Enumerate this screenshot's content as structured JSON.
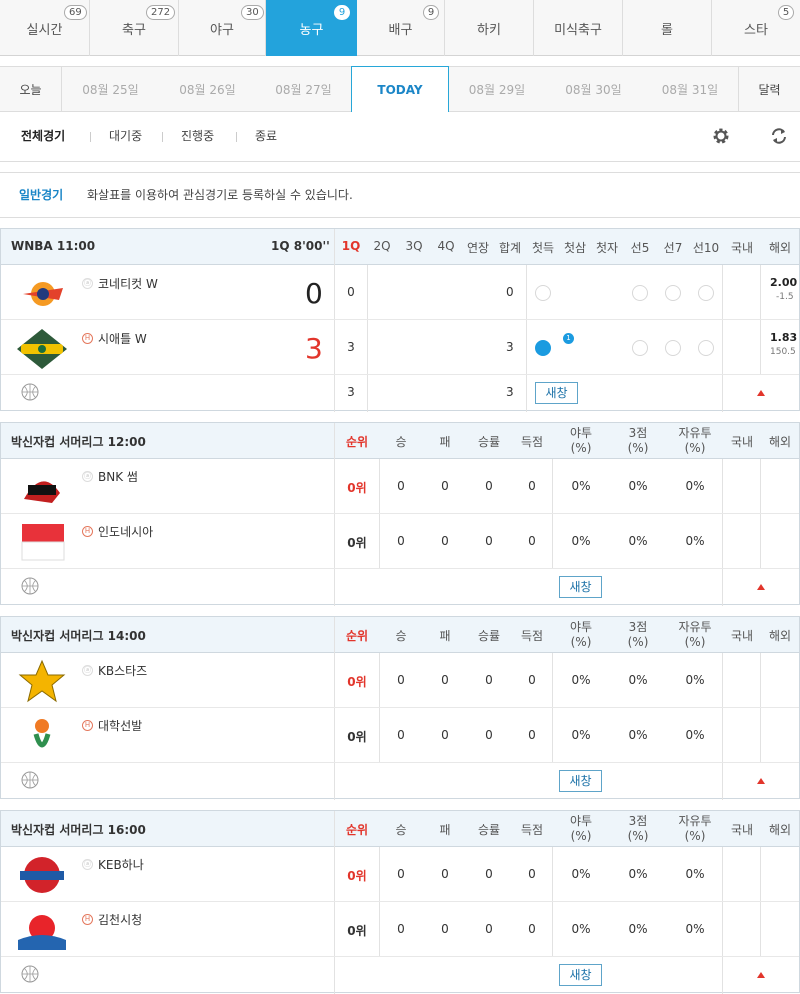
{
  "sport_tabs": [
    {
      "label": "실시간",
      "count": "69"
    },
    {
      "label": "축구",
      "count": "272"
    },
    {
      "label": "야구",
      "count": "30"
    },
    {
      "label": "농구",
      "count": "9",
      "active": true
    },
    {
      "label": "배구",
      "count": "9"
    },
    {
      "label": "하키",
      "count": ""
    },
    {
      "label": "미식축구",
      "count": ""
    },
    {
      "label": "롤",
      "count": ""
    },
    {
      "label": "스타",
      "count": "5"
    }
  ],
  "dates": [
    "오늘",
    "08월 25일",
    "08월 26일",
    "08월 27일",
    "TODAY",
    "08월 29일",
    "08월 30일",
    "08월 31일",
    "달력"
  ],
  "filters": [
    "전체경기",
    "대기중",
    "진행중",
    "종료"
  ],
  "notice": {
    "label": "일반경기",
    "text": "화살표를 이용하여 관심경기로 등록하실 수 있습니다."
  },
  "wnba": {
    "league": "WNBA  11:00",
    "status": "1Q 8'00''",
    "cols": [
      "1Q",
      "2Q",
      "3Q",
      "4Q",
      "연장",
      "합계",
      "첫득",
      "첫삼",
      "첫자",
      "선5",
      "선7",
      "선10",
      "국내",
      "해외"
    ],
    "home": {
      "name": "코네티컷 W",
      "badge": "ⓐ",
      "score": "0",
      "q1": "0",
      "total": "0",
      "odds": "2.00",
      "handicap": "-1.5"
    },
    "away": {
      "name": "시애틀 W",
      "badge": "H",
      "score": "3",
      "q1": "3",
      "total": "3",
      "odds": "1.83",
      "handicap": "150.5",
      "first_badge": "1"
    },
    "sum": {
      "q1": "3",
      "total": "3"
    },
    "new_btn": "새창"
  },
  "standings_cols": {
    "rank": "순위",
    "w": "승",
    "l": "패",
    "pct": "승률",
    "pts": "득점",
    "fg": "야투",
    "fg2": "(%)",
    "tp": "3점",
    "tp2": "(%)",
    "ft": "자유투",
    "ft2": "(%)",
    "dom": "국내",
    "ovs": "해외"
  },
  "games": [
    {
      "title": "박신자컵 서머리그  12:00",
      "teams": [
        {
          "name": "BNK 썸",
          "badge": "ⓐ",
          "rank": "0위",
          "red": true
        },
        {
          "name": "인도네시아",
          "badge": "H",
          "rank": "0위",
          "red": false
        }
      ],
      "new_btn": "새창"
    },
    {
      "title": "박신자컵 서머리그  14:00",
      "teams": [
        {
          "name": "KB스타즈",
          "badge": "ⓐ",
          "rank": "0위",
          "red": true
        },
        {
          "name": "대학선발",
          "badge": "H",
          "rank": "0위",
          "red": false
        }
      ],
      "new_btn": "새창"
    },
    {
      "title": "박신자컵 서머리그  16:00",
      "teams": [
        {
          "name": "KEB하나",
          "badge": "ⓐ",
          "rank": "0위",
          "red": true
        },
        {
          "name": "김천시청",
          "badge": "H",
          "rank": "0위",
          "red": false
        }
      ],
      "new_btn": "새창"
    }
  ],
  "zero": "0",
  "pct_zero": "0%",
  "colors": {
    "accent": "#23a3dc",
    "red": "#e2352b",
    "header_bg": "#eef5fa"
  }
}
